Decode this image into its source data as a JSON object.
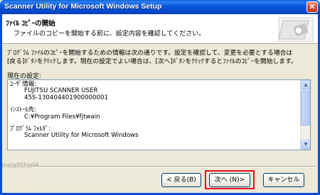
{
  "window": {
    "title": "Scanner Utility for Microsoft Windows Setup",
    "close_glyph": "✕"
  },
  "header": {
    "title": "ﾌｧｲﾙ ｺﾋﾟｰの開始",
    "subtitle": "ファイルのコピーを開始する前に、設定内容を確認してください。"
  },
  "description": {
    "line1": "ﾌﾟﾛｸﾞﾗﾑ ﾌｧｲﾙのｺﾋﾟｰを開始するための情報は次の通りです。設定を確認して、変更を必要とする場合は",
    "line2": "[戻る]ﾎﾞﾀﾝをｸﾘｯｸします。現在の設定でよい場合は、[次へ]ﾎﾞﾀﾝをｸﾘｯｸするとﾌｧｲﾙのｺﾋﾟｰを開始します。"
  },
  "current_settings_label": "現在の設定:",
  "settings": {
    "user_label": "ﾕｰｻﾞ情報:",
    "user_name": "FUJITSU SCANNER USER",
    "serial": "45S-130404401900000001",
    "install_label": "ｲﾝｽﾄｰﾙ先:",
    "install_path": "C:¥Program Files¥fjtwain",
    "folder_label": "ﾌﾟﾛｸﾞﾗﾑ ﾌｫﾙﾀﾞ:",
    "folder_name": "Scanner Utility for Microsoft Windows"
  },
  "footer": {
    "brand": "InstallShield"
  },
  "buttons": {
    "back": "< 戻る(B)",
    "next": "次へ (N)>",
    "cancel": "キャンセル"
  },
  "scrollbar": {
    "up_glyph": "▲",
    "down_glyph": "▼",
    "position_fraction": 0.05,
    "visible_fraction": 0.7
  },
  "colors": {
    "titlebar": "#0855dd",
    "highlight": "#e8101c",
    "window_bg": "#ece9d8"
  }
}
